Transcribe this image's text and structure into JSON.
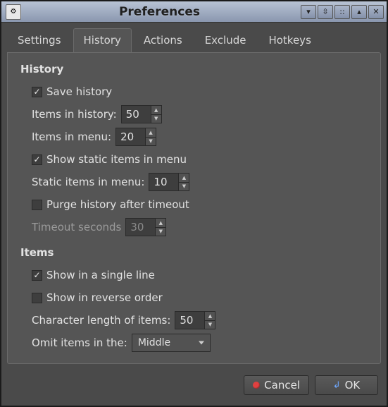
{
  "window": {
    "title": "Preferences"
  },
  "tabs": {
    "t0": "Settings",
    "t1": "History",
    "t2": "Actions",
    "t3": "Exclude",
    "t4": "Hotkeys"
  },
  "history": {
    "section": "History",
    "save": "Save history",
    "items_in_history_label": "Items in history:",
    "items_in_history_value": "50",
    "items_in_menu_label": "Items in menu:",
    "items_in_menu_value": "20",
    "show_static": "Show static items in menu",
    "static_items_label": "Static items in menu:",
    "static_items_value": "10",
    "purge": "Purge history after timeout",
    "timeout_label": "Timeout seconds",
    "timeout_value": "30"
  },
  "items": {
    "section": "Items",
    "single_line": "Show in a single line",
    "reverse": "Show in reverse order",
    "char_len_label": "Character length of items:",
    "char_len_value": "50",
    "omit_label": "Omit items in the:",
    "omit_value": "Middle"
  },
  "buttons": {
    "cancel": "Cancel",
    "ok": "OK"
  }
}
